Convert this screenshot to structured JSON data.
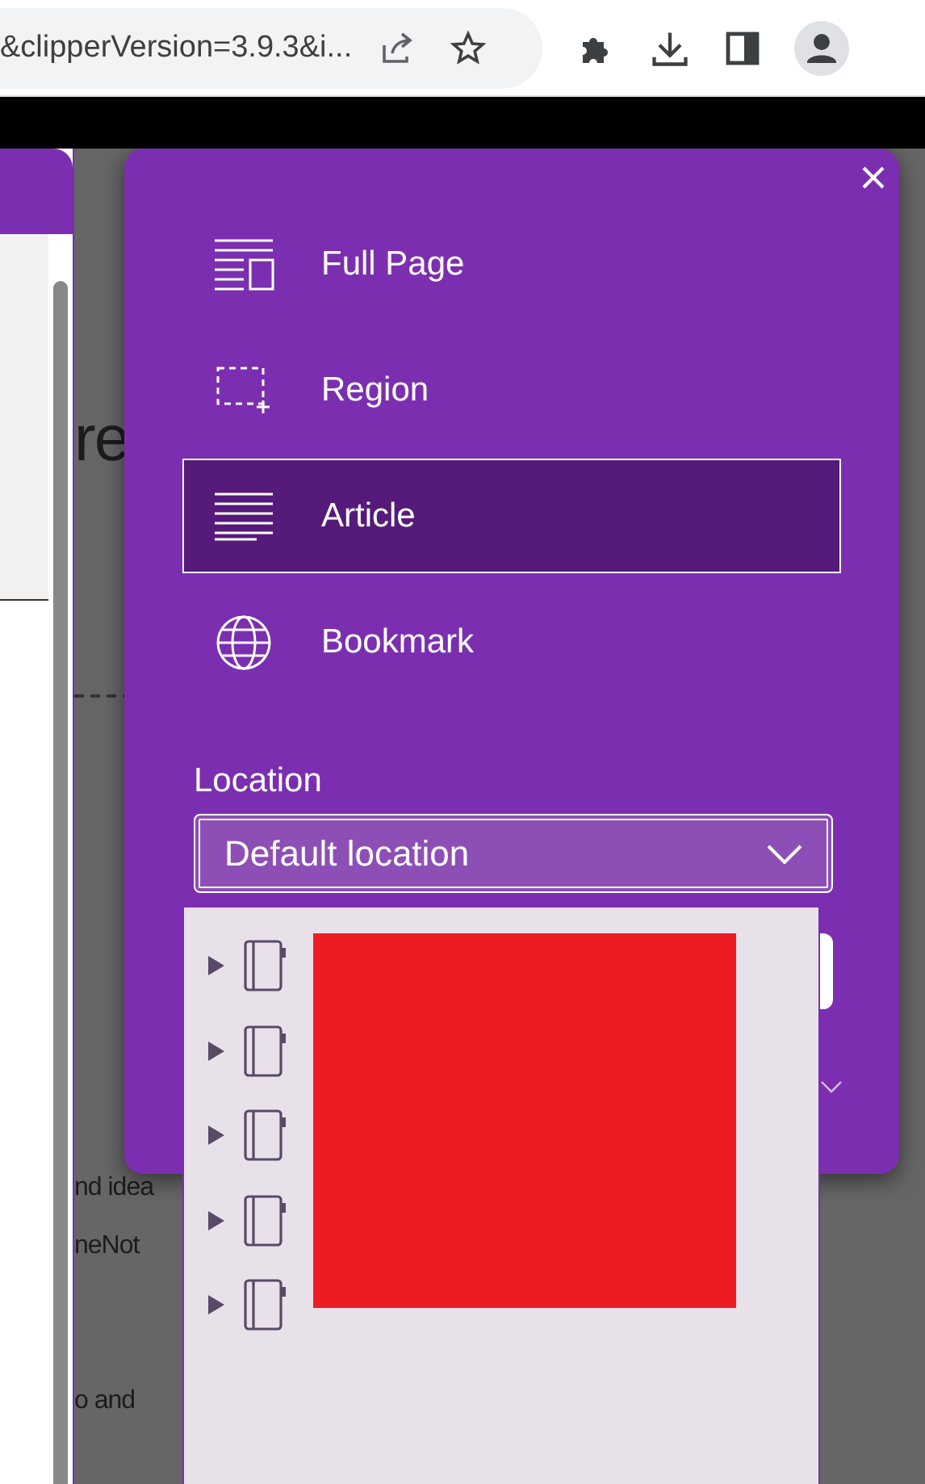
{
  "browser": {
    "address": "&clipperVersion=3.9.3&i..."
  },
  "page": {
    "heading_fragment": "re",
    "lines": [
      "nd idea",
      "neNot",
      "o and"
    ]
  },
  "clipper": {
    "modes": [
      {
        "label": "Full Page",
        "kind": "fullpage",
        "selected": false
      },
      {
        "label": "Region",
        "kind": "region",
        "selected": false
      },
      {
        "label": "Article",
        "kind": "article",
        "selected": true
      },
      {
        "label": "Bookmark",
        "kind": "bookmark",
        "selected": false
      }
    ],
    "location": {
      "label": "Location",
      "value": "Default location"
    },
    "notebooks": [
      {
        "expanded": false
      },
      {
        "expanded": false
      },
      {
        "expanded": false
      },
      {
        "expanded": false
      },
      {
        "expanded": false
      }
    ]
  }
}
